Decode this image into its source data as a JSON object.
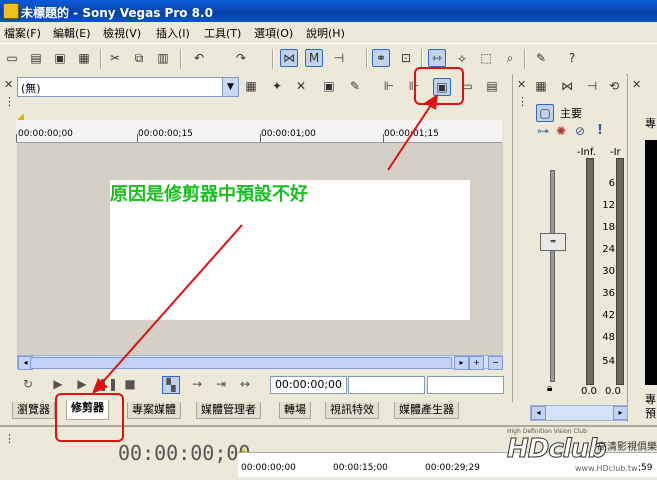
{
  "window": {
    "title": "未標題的 - Sony Vegas Pro 8.0"
  },
  "menu": [
    "檔案(F)",
    "編輯(E)",
    "檢視(V)",
    "插入(I)",
    "工具(T)",
    "選項(O)",
    "說明(H)"
  ],
  "trimmer": {
    "media_selected": "(無)",
    "ruler_ticks": [
      "00:00:00;00",
      "00:00:00;15",
      "00:00:01;00",
      "00:00:01;15"
    ],
    "timecode": "00:00:00;00"
  },
  "annotation": "原因是修剪器中預設不好",
  "tabs": [
    {
      "label": "瀏覽器",
      "active": false
    },
    {
      "label": "修剪器",
      "active": true
    },
    {
      "label": "專案媒體",
      "active": false
    },
    {
      "label": "媒體管理者",
      "active": false
    },
    {
      "label": "轉場",
      "active": false
    },
    {
      "label": "視訊特效",
      "active": false
    },
    {
      "label": "媒體產生器",
      "active": false
    }
  ],
  "mixer": {
    "label": "主要",
    "peak_left": "-Inf.",
    "peak_right": "-Ir",
    "scale": [
      "6",
      "12",
      "18",
      "24",
      "30",
      "36",
      "42",
      "48",
      "54"
    ],
    "value_a": "0.0",
    "value_b": "0.0"
  },
  "right_strip": {
    "text_top": "專",
    "text_bottom": "專\n預"
  },
  "timeline": {
    "timecode": "00:00:00;00",
    "ruler_ticks": [
      "00:00:00;00",
      "00:00:15;00",
      "00:00:29;29"
    ],
    "ruler_tail": ";59"
  },
  "watermark": {
    "brand": "HDclub",
    "tagline": "High Definition Vision Club",
    "cn_name": "高清影視俱樂部",
    "url": "www.HDclub.tw"
  },
  "colors": {
    "annotation": "#18c01e",
    "highlight": "#e01010",
    "titlebar": "#0a5bd9"
  }
}
